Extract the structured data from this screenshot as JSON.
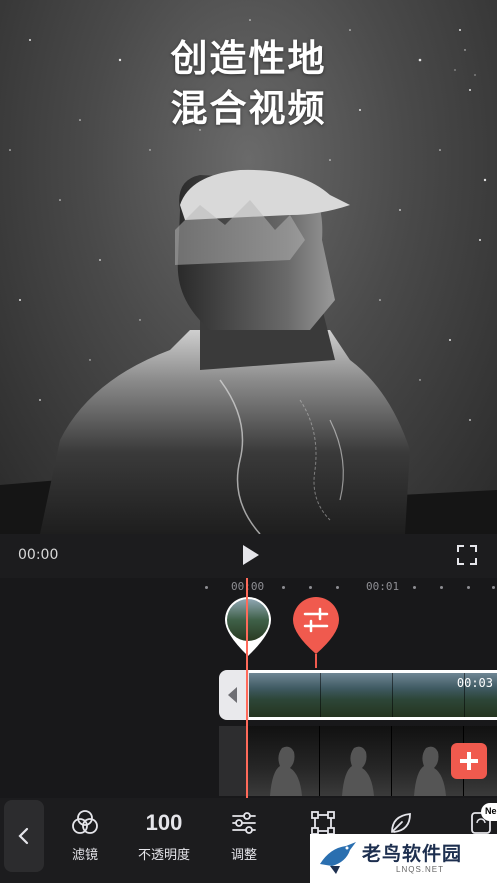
{
  "preview": {
    "headline_line1": "创造性地",
    "headline_line2": "混合视频"
  },
  "controls": {
    "current_time": "00:00"
  },
  "timeline": {
    "ruler_marks": [
      "00:00",
      "00:01"
    ],
    "clip_duration": "00:03"
  },
  "toolbar": {
    "tools": [
      {
        "label": "滤镜",
        "icon": "filter-icon"
      },
      {
        "label": "不透明度",
        "value": "100"
      },
      {
        "label": "调整",
        "icon": "sliders-icon"
      },
      {
        "label": "",
        "icon": "transform-icon"
      },
      {
        "label": "",
        "icon": "leaf-icon"
      },
      {
        "label": "",
        "icon": "replace-icon"
      }
    ],
    "new_badge": "Ne"
  },
  "watermark": {
    "text": "老鸟软件园",
    "sub": "LNQS.NET"
  },
  "colors": {
    "accent": "#f05a4e",
    "playhead": "#ff6a5a",
    "background": "#1c1c1e"
  }
}
